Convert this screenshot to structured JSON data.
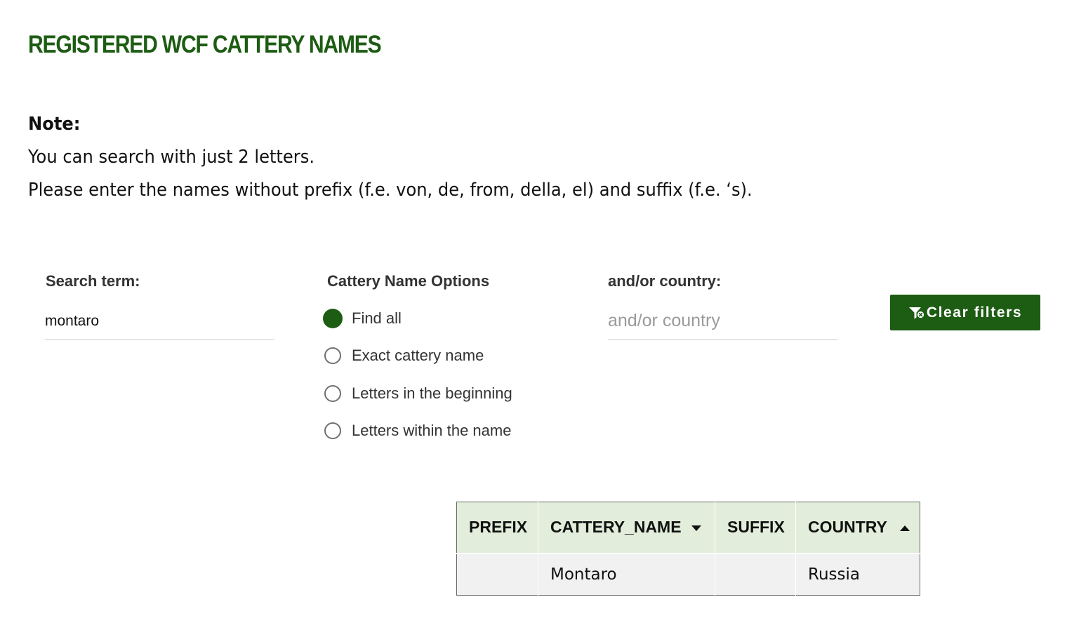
{
  "page": {
    "title": "REGISTERED WCF CATTERY NAMES"
  },
  "note": {
    "heading": "Note:",
    "lines": [
      "You can search with just 2 letters.",
      "Please enter the names without prefix (f.e. von, de, from, della, el) and suffix (f.e. ‘s)."
    ]
  },
  "filters": {
    "search": {
      "label": "Search term:",
      "value": "montaro"
    },
    "options": {
      "label": "Cattery Name Options",
      "items": [
        {
          "label": "Find all",
          "selected": true
        },
        {
          "label": "Exact cattery name",
          "selected": false
        },
        {
          "label": "Letters in the beginning",
          "selected": false
        },
        {
          "label": "Letters within the name",
          "selected": false
        }
      ]
    },
    "country": {
      "label": "and/or country:",
      "placeholder": "and/or country",
      "value": ""
    },
    "clear_button": {
      "label": "Clear filters",
      "icon": "filter-clear-icon"
    }
  },
  "table": {
    "columns": [
      {
        "label": "PREFIX",
        "sort": null
      },
      {
        "label": "CATTERY_NAME",
        "sort": "descending"
      },
      {
        "label": "SUFFIX",
        "sort": null
      },
      {
        "label": "COUNTRY",
        "sort": "ascending"
      }
    ],
    "rows": [
      {
        "prefix": "",
        "cattery_name": "Montaro",
        "suffix": "",
        "country": "Russia"
      }
    ]
  },
  "colors": {
    "brand_green": "#1d5c13",
    "table_header_bg": "#e2eedb",
    "table_row_bg": "#f1f1f1"
  }
}
